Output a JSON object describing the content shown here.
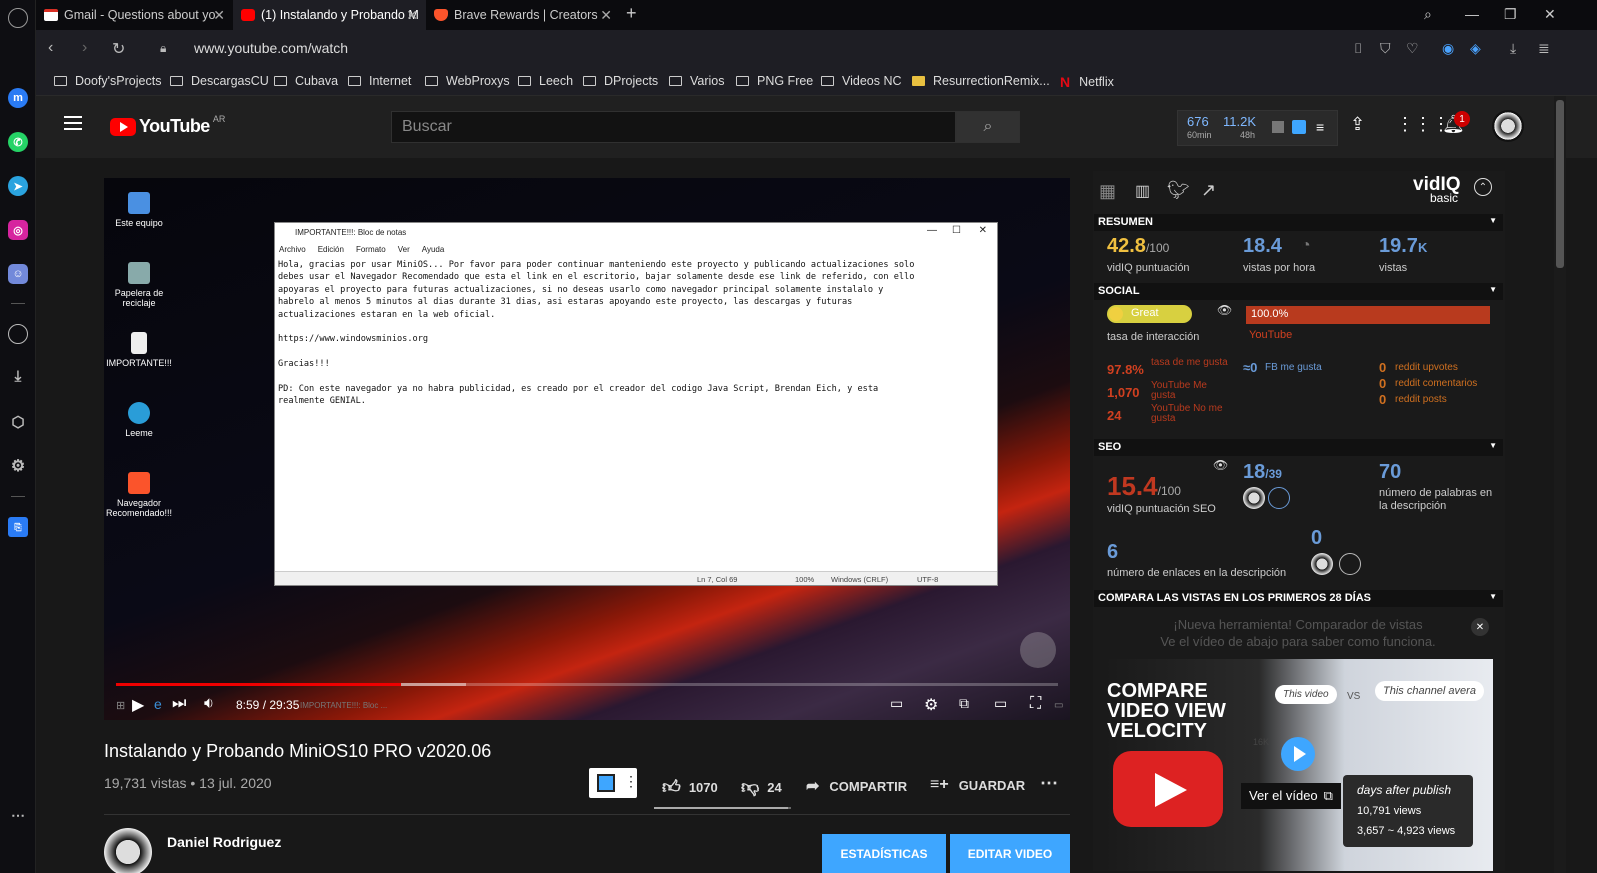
{
  "tabs": [
    {
      "title": "Gmail - Questions about yo",
      "active": false
    },
    {
      "title": "(1) Instalando y Probando M",
      "active": true
    },
    {
      "title": "Brave Rewards | Creators",
      "active": false
    }
  ],
  "address": {
    "url": "www.youtube.com/watch"
  },
  "bookmarks": [
    "Doofy'sProjects",
    "DescargasCU",
    "Cubava",
    "Internet",
    "WebProxys",
    "Leech",
    "DProjects",
    "Varios",
    "PNG Free",
    "Videos NC",
    "ResurrectionRemix...",
    "Netflix"
  ],
  "youtube": {
    "logo_text": "YouTube",
    "region": "AR",
    "search_placeholder": "Buscar",
    "views_60min": "676",
    "views_60min_label": "60min",
    "views_48h": "11.2K",
    "views_48h_label": "48h",
    "notifications": "1"
  },
  "player": {
    "desktop_icons": [
      "Este equipo",
      "Papelera de reciclaje",
      "IMPORTANTE!!!",
      "Leeme",
      "Navegador Recomendado!!!"
    ],
    "notepad": {
      "title": "IMPORTANTE!!!: Bloc de notas",
      "menu": [
        "Archivo",
        "Edición",
        "Formato",
        "Ver",
        "Ayuda"
      ],
      "text": "Hola, gracias por usar MiniOS... Por favor para poder continuar manteniendo este proyecto y publicando actualizaciones solo\ndebes usar el Navegador Recomendado que esta el link en el escritorio, bajar solamente desde ese link de referido, con ello\napoyaras el proyecto para futuras actualizaciones, si no deseas usarlo como navegador principal solamente instalalo y\nhabrelo al menos 5 minutos al dias durante 31 dias, asi estaras apoyando este proyecto, las descargas y futuras\nactualizaciones estaran en la web oficial.\n\nhttps://www.windowsminios.org\n\nGracias!!!\n\nPD: Con este navegador ya no habra publicidad, es creado por el creador del codigo Java Script, Brendan Eich, y esta\nrealmente GENIAL.",
      "status_pos": "Ln 7, Col 69",
      "status_zoom": "100%",
      "status_eol": "Windows (CRLF)",
      "status_enc": "UTF-8"
    },
    "time": "8:59 / 29:35",
    "taskbar_label": "IMPORTANTE!!!: Bloc ...",
    "played_fraction": 0.303,
    "buffered_fraction": 0.372
  },
  "video": {
    "title": "Instalando y Probando MiniOS10 PRO v2020.06",
    "meta": "19,731 vistas • 13 jul. 2020",
    "likes": "1070",
    "dislikes": "24",
    "share": "COMPARTIR",
    "save": "GUARDAR",
    "channel": "Daniel Rodriguez",
    "btn_stats": "ESTADÍSTICAS",
    "btn_edit": "EDITAR VIDEO"
  },
  "vidiq": {
    "brand": "vidIQ",
    "tier": "basic",
    "resumen": {
      "header": "RESUMEN",
      "score": "42.8",
      "score_den": "/100",
      "score_label": "vidIQ puntuación",
      "vph": "18.4",
      "vph_label": "vistas por hora",
      "views": "19.7",
      "views_unit": "K",
      "views_label": "vistas"
    },
    "social": {
      "header": "SOCIAL",
      "engagement_badge": "Great",
      "engagement_label": "tasa de interacción",
      "yt_share": "100.0%",
      "yt_label": "YouTube",
      "like_rate": "97.8%",
      "like_rate_label": "tasa de me gusta",
      "yt_likes": "1,070",
      "yt_likes_label": "YouTube Me gusta",
      "yt_dislikes": "24",
      "yt_dislikes_label": "YouTube No me gusta",
      "fb_likes": "≈0",
      "fb_likes_label": "FB me gusta",
      "reddit_upvotes": "0",
      "reddit_upvotes_label": "reddit upvotes",
      "reddit_comments": "0",
      "reddit_comments_label": "reddit comentarios",
      "reddit_posts": "0",
      "reddit_posts_label": "reddit posts"
    },
    "seo": {
      "header": "SEO",
      "score": "15.4",
      "score_den": "/100",
      "score_label": "vidIQ puntuación SEO",
      "tags": "18",
      "tags_den": "/39",
      "words": "70",
      "words_label": "número de palabras en la descripción",
      "links": "6",
      "links_label": "número de enlaces en la descripción",
      "backlinks": "0"
    },
    "compare": {
      "header": "COMPARA LAS VISTAS EN LOS PRIMEROS 28 DÍAS",
      "line1": "¡Nueva herramienta! Comparador de vistas",
      "line2": "Ve el vídeo de abajo para saber como funciona.",
      "thumb_title": "COMPARE VIDEO VIEW VELOCITY",
      "this_video": "This video",
      "vs": "VS",
      "channel_avg": "This channel avera",
      "axis": "16K",
      "days": "days after publish",
      "views1": "10,791 views",
      "views2": "3,657 ~ 4,923 views",
      "watch": "Ver el vídeo"
    }
  }
}
